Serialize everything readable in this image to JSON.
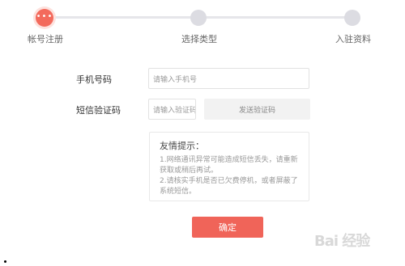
{
  "steps": [
    {
      "label": "帐号注册",
      "active": true,
      "icon_text": "•••"
    },
    {
      "label": "选择类型",
      "active": false
    },
    {
      "label": "入驻资料",
      "active": false
    }
  ],
  "form": {
    "phone": {
      "label": "手机号码",
      "placeholder": "请输入手机号"
    },
    "code": {
      "label": "短信验证码",
      "placeholder": "请输入验证码",
      "send_button": "发送验证码"
    }
  },
  "tips": {
    "title": "友情提示：",
    "lines": [
      "1.网络通讯异常可能造成短信丢失，请重新",
      "获取或稍后再试。",
      "2.请核实手机是否已欠费停机，或者屏蔽了",
      "系统短信。"
    ]
  },
  "confirm_button": "确定",
  "watermark": "Bai 经验",
  "colors": {
    "accent": "#f06459",
    "inactive": "#dcdce2",
    "track": "#e6e6ea"
  }
}
